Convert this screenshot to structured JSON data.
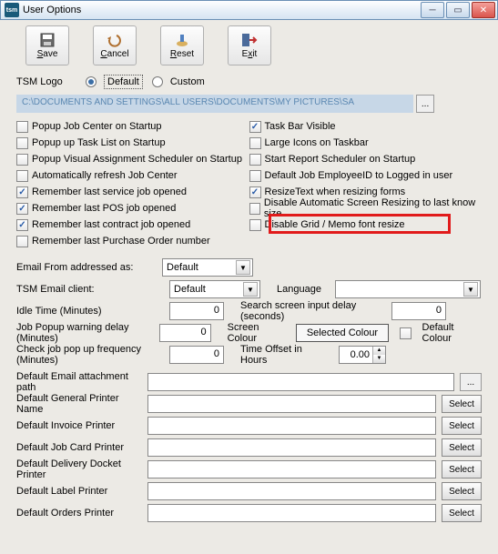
{
  "window": {
    "title": "User Options",
    "app_icon_text": "tsm"
  },
  "toolbar": {
    "save": "Save",
    "cancel": "Cancel",
    "reset": "Reset",
    "exit": "Exit"
  },
  "logo": {
    "label": "TSM Logo",
    "default": "Default",
    "custom": "Custom",
    "path": "C:\\DOCUMENTS AND SETTINGS\\ALL USERS\\DOCUMENTS\\MY PICTURES\\SA",
    "browse": "..."
  },
  "left_checks": [
    {
      "label": "Popup Job Center on Startup",
      "checked": false
    },
    {
      "label": "Popup up Task List on Startup",
      "checked": false
    },
    {
      "label": "Popup Visual Assignment Scheduler on Startup",
      "checked": false
    },
    {
      "label": "Automatically refresh Job Center",
      "checked": false
    },
    {
      "label": "Remember last service job opened",
      "checked": true
    },
    {
      "label": "Remember last POS job opened",
      "checked": true
    },
    {
      "label": "Remember last contract job opened",
      "checked": true
    },
    {
      "label": "Remember last Purchase Order number",
      "checked": false
    }
  ],
  "right_checks": [
    {
      "label": "Task Bar Visible",
      "checked": true
    },
    {
      "label": "Large Icons on Taskbar",
      "checked": false
    },
    {
      "label": "Start Report Scheduler on Startup",
      "checked": false
    },
    {
      "label": "Default Job EmployeeID to Logged in user",
      "checked": false
    },
    {
      "label": "ResizeText when resizing forms",
      "checked": true
    },
    {
      "label": "Disable Automatic Screen Resizing to last know size",
      "checked": false
    },
    {
      "label": "Disable Grid / Memo font resize",
      "checked": false
    }
  ],
  "fields": {
    "email_from_label": "Email From addressed as:",
    "email_from_value": "Default",
    "tsm_email_label": "TSM Email client:",
    "tsm_email_value": "Default",
    "language_label": "Language",
    "language_value": "",
    "idle_label": "Idle Time (Minutes)",
    "idle_value": "0",
    "search_delay_label": "Search screen input delay (seconds)",
    "search_delay_value": "0",
    "job_popup_label": "Job Popup warning delay (Minutes)",
    "job_popup_value": "0",
    "screen_colour_label": "Screen Colour",
    "screen_colour_value": "Selected Colour",
    "default_colour_label": "Default Colour",
    "check_freq_label": "Check job pop up frequency (Minutes)",
    "check_freq_value": "0",
    "time_offset_label": "Time Offset in Hours",
    "time_offset_value": "0.00"
  },
  "printers": {
    "attach_label": "Default Email attachment path",
    "attach_browse": "...",
    "rows": [
      {
        "label": "Default General Printer Name"
      },
      {
        "label": "Default Invoice Printer"
      },
      {
        "label": "Default Job Card Printer"
      },
      {
        "label": "Default Delivery Docket Printer"
      },
      {
        "label": "Default  Label Printer"
      },
      {
        "label": "Default Orders Printer"
      }
    ],
    "select": "Select"
  }
}
